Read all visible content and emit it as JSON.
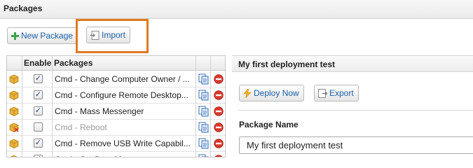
{
  "header": {
    "title": "Packages"
  },
  "toolbar": {
    "new_package_label": "New Package",
    "import_label": "Import"
  },
  "table": {
    "columns": [
      "Enable",
      "Packages"
    ],
    "rows": [
      {
        "name": "Cmd - Change Computer Owner / ...",
        "enabled": true,
        "checked": true
      },
      {
        "name": "Cmd - Configure Remote Desktop...",
        "enabled": true,
        "checked": true
      },
      {
        "name": "Cmd - Mass Messenger",
        "enabled": true,
        "checked": true
      },
      {
        "name": "Cmd - Reboot",
        "enabled": false,
        "checked": false
      },
      {
        "name": "Cmd - Remove USB Write Capabil...",
        "enabled": true,
        "checked": true
      },
      {
        "name": "Cmd - Set Boot M...",
        "enabled": true,
        "checked": true
      }
    ]
  },
  "detail": {
    "title": "My first deployment test",
    "deploy_label": "Deploy Now",
    "export_label": "Export",
    "package_name_label": "Package Name",
    "package_name_value": "My first deployment test"
  },
  "colors": {
    "highlight": "#e07b20",
    "link": "#1a5fa8",
    "delete": "#d83a2e",
    "package": "#e8b23a"
  }
}
